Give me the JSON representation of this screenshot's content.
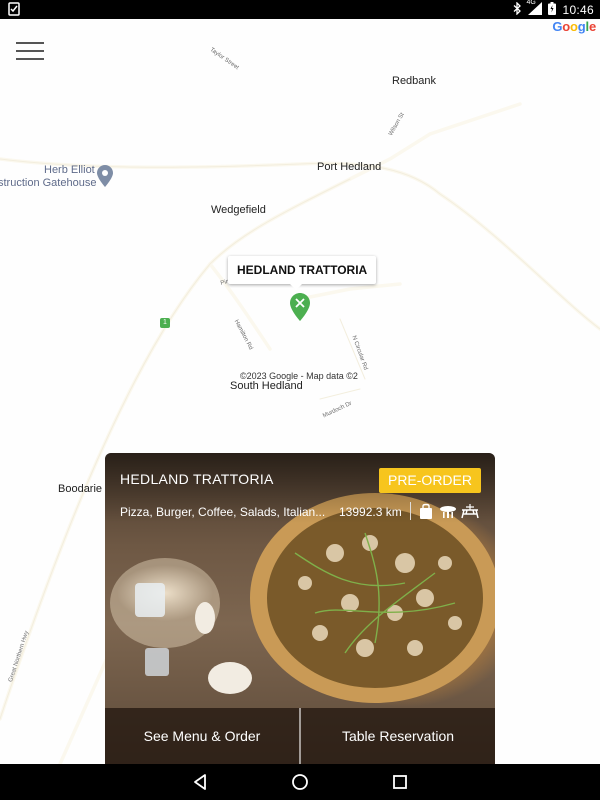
{
  "status_bar": {
    "time": "10:46",
    "network": "4G",
    "icons": [
      "clipboard-check-icon",
      "bluetooth-icon",
      "signal-icon",
      "battery-icon"
    ]
  },
  "map": {
    "attribution": "Google",
    "copyright": "©2023 Google - Map data ©2",
    "route_number": "1",
    "places": {
      "redbank": "Redbank",
      "herb_elliot": "Herb Elliot",
      "gatehouse": "struction Gatehouse",
      "port_hedland": "Port Hedland",
      "wedgefield": "Wedgefield",
      "south_hedland": "South Hedland",
      "boodarie": "Boodarie"
    },
    "streets": {
      "taylor": "Taylor Street",
      "wilson": "Wilson St",
      "hamilton": "Hamilton Rd",
      "north_circular": "N Circular Rd",
      "murdoch": "Murdoch Dr",
      "great_northern": "Great Northern Hwy",
      "pinga": "Pinga"
    },
    "marker_label": "HEDLAND TRATTORIA"
  },
  "restaurant": {
    "name": "HEDLAND TRATTORIA",
    "preorder_label": "PRE-ORDER",
    "cuisine": "Pizza, Burger, Coffee, Salads, Italian...",
    "distance": "13992.3 km",
    "service_icons": [
      "takeaway-bag-icon",
      "dine-in-icon",
      "outdoor-seating-icon"
    ],
    "menu_button": "See Menu & Order",
    "reservation_button": "Table Reservation"
  },
  "colors": {
    "accent": "#f7c51d",
    "marker": "#4caf50"
  }
}
